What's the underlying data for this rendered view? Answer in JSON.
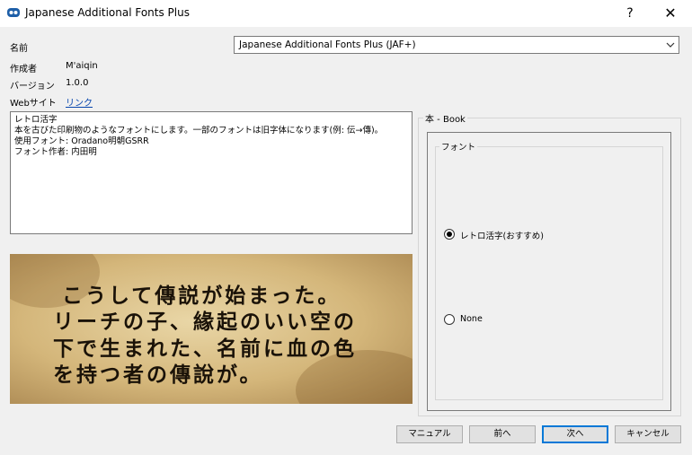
{
  "window": {
    "title": "Japanese Additional Fonts Plus",
    "help": "?",
    "close": "✕"
  },
  "info": {
    "name_label": "名前",
    "author_label": "作成者",
    "author_value": "M'aiqin",
    "version_label": "バージョン",
    "version_value": "1.0.0",
    "website_label": "Webサイト",
    "website_link": "リンク"
  },
  "select": {
    "value": "Japanese Additional Fonts Plus (JAF+)"
  },
  "description": {
    "lines": [
      "レトロ活字",
      "本を古びた印刷物のようなフォントにします。一部のフォントは旧字体になります(例: 伝→傳)。",
      "",
      "使用フォント: Oradano明朝GSRR",
      "フォント作者: 内田明"
    ]
  },
  "preview": {
    "lines": [
      "こうして傳説が始まった。",
      "リーチの子、緣起のいい空の",
      "下で生まれた、名前に血の色",
      "を持つ者の傳說が。"
    ]
  },
  "options": {
    "group_title": "本 - Book",
    "subgroup_title": "フォント",
    "radios": [
      {
        "label": "レトロ活字(おすすめ)",
        "selected": true
      },
      {
        "label": "None",
        "selected": false
      }
    ]
  },
  "buttons": {
    "manual": "マニュアル",
    "back": "前へ",
    "next": "次へ",
    "cancel": "キャンセル"
  }
}
